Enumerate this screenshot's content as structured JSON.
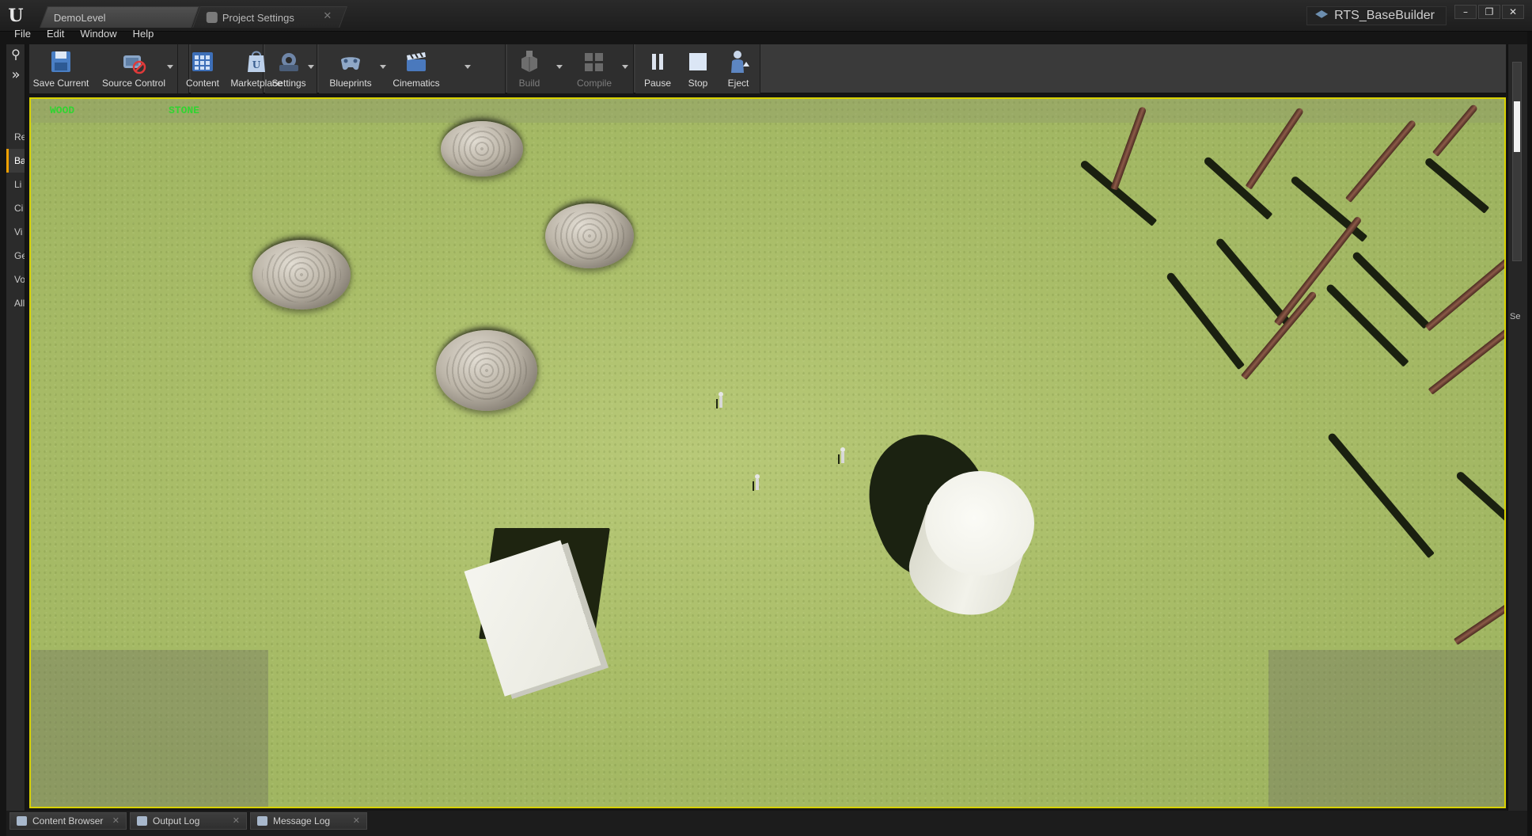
{
  "titlebar": {
    "tabs": [
      {
        "label": "DemoLevel",
        "active": true
      },
      {
        "label": "Project Settings",
        "active": false
      }
    ],
    "project_name": "RTS_BaseBuilder",
    "window_buttons": {
      "minimize": "–",
      "restore": "❐",
      "close": "✕"
    }
  },
  "menu": [
    "File",
    "Edit",
    "Window",
    "Help"
  ],
  "left_panel": {
    "tabs": [
      "Re",
      "Ba",
      "Li",
      "Ci",
      "Vi",
      "Ge",
      "Vo",
      "All"
    ],
    "active_tab": "Ba"
  },
  "toolbar": {
    "buttons": [
      {
        "label": "Save Current",
        "icon": "floppy-disk-icon",
        "enabled": true
      },
      {
        "label": "Source Control",
        "icon": "source-control-icon",
        "enabled": true
      },
      {
        "label": "Content",
        "icon": "content-grid-icon",
        "enabled": true
      },
      {
        "label": "Marketplace",
        "icon": "marketplace-icon",
        "enabled": true
      },
      {
        "label": "Settings",
        "icon": "gears-icon",
        "enabled": true
      },
      {
        "label": "Blueprints",
        "icon": "blueprint-controller-icon",
        "enabled": true
      },
      {
        "label": "Cinematics",
        "icon": "clapperboard-icon",
        "enabled": true
      },
      {
        "label": "Build",
        "icon": "build-icon",
        "enabled": false
      },
      {
        "label": "Compile",
        "icon": "compile-icon",
        "enabled": false
      },
      {
        "label": "Pause",
        "icon": "pause-icon",
        "enabled": true
      },
      {
        "label": "Stop",
        "icon": "stop-icon",
        "enabled": true
      },
      {
        "label": "Eject",
        "icon": "eject-icon",
        "enabled": true
      }
    ]
  },
  "viewport": {
    "hud": {
      "wood_label": "WOOD",
      "wood_value": "",
      "stone_label": "STONE",
      "stone_value": ""
    },
    "border_color": "#d9d200"
  },
  "right_panel": {
    "tab_label": "Se"
  },
  "bottom_tabs": [
    {
      "label": "Content Browser",
      "icon": "content-browser-icon"
    },
    {
      "label": "Output Log",
      "icon": "output-log-icon"
    },
    {
      "label": "Message Log",
      "icon": "message-log-icon"
    }
  ],
  "colors": {
    "accent": "#f0a000",
    "hud_green": "#31d431",
    "grass": "#a9bd68"
  }
}
